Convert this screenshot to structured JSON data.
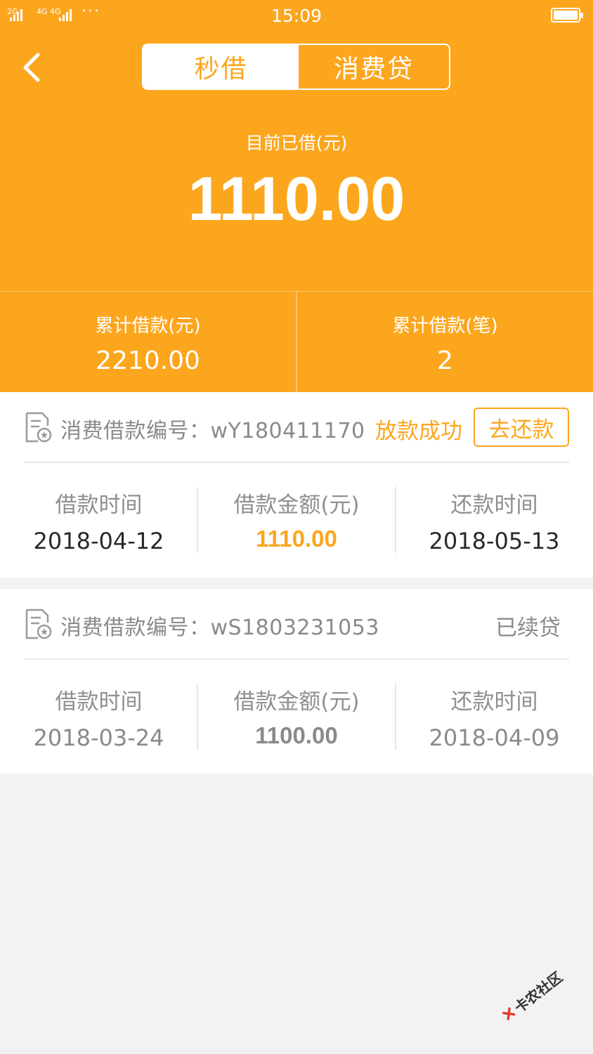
{
  "status_bar": {
    "network_left": "2G",
    "network_mid": "4G 4G",
    "dots": "···",
    "time": "15:09"
  },
  "tabs": [
    {
      "label": "秒借",
      "active": true
    },
    {
      "label": "消费贷",
      "active": false
    }
  ],
  "summary": {
    "current_label": "目前已借(元)",
    "current_amount": "1110.00",
    "total_amount_label": "累计借款(元)",
    "total_amount_value": "2210.00",
    "total_count_label": "累计借款(笔)",
    "total_count_value": "2"
  },
  "loans": [
    {
      "number_text": "消费借款编号：wY180411170",
      "status": "放款成功",
      "action_label": "去还款",
      "col1_label": "借款时间",
      "col1_value": "2018-04-12",
      "col2_label": "借款金额(元)",
      "col2_value": "1110.00",
      "col3_label": "还款时间",
      "col3_value": "2018-05-13"
    },
    {
      "number_text": "消费借款编号：wS1803231053",
      "status": "已续贷",
      "col1_label": "借款时间",
      "col1_value": "2018-03-24",
      "col2_label": "借款金额(元)",
      "col2_value": "1100.00",
      "col3_label": "还款时间",
      "col3_value": "2018-04-09"
    }
  ],
  "watermark": {
    "text": "卡农社区"
  },
  "colors": {
    "brand_orange": "#fca61e",
    "gray_text": "#8a8a8a",
    "page_bg": "#f2f2f4"
  }
}
